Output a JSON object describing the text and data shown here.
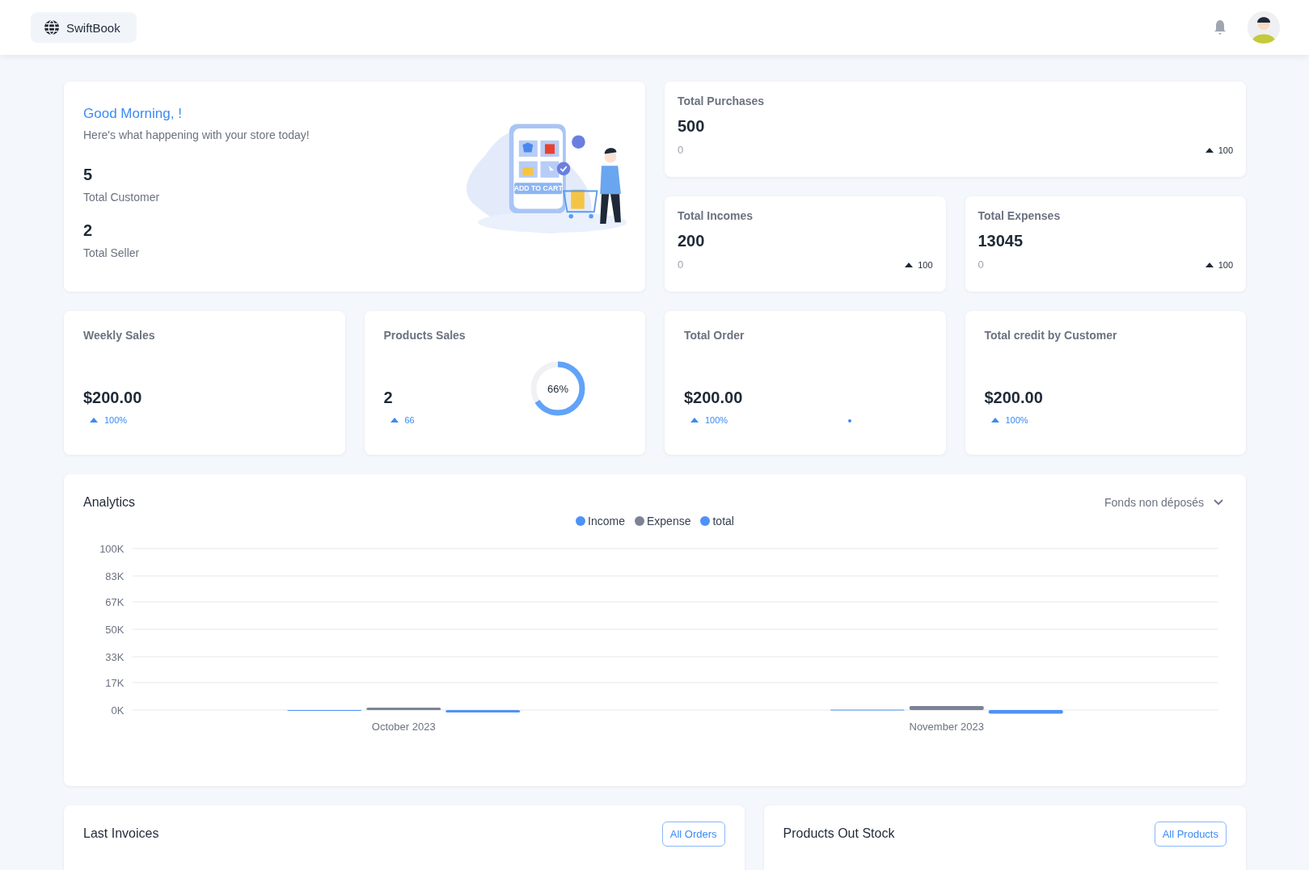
{
  "header": {
    "brand": "SwiftBook"
  },
  "greeting": {
    "title": "Good Morning, !",
    "subtitle": "Here's what happening with your store today!",
    "illustration_label": "ADD TO CART",
    "stats": [
      {
        "value": "5",
        "label": "Total Customer"
      },
      {
        "value": "2",
        "label": "Total Seller"
      }
    ]
  },
  "summary_cards": [
    {
      "label": "Total Purchases",
      "value": "500",
      "sub": "0",
      "trend": "100"
    },
    {
      "label": "Total Incomes",
      "value": "200",
      "sub": "0",
      "trend": "100"
    },
    {
      "label": "Total Expenses",
      "value": "13045",
      "sub": "0",
      "trend": "100"
    }
  ],
  "metric_cards": [
    {
      "kind": "plain",
      "label": "Weekly Sales",
      "value": "$200.00",
      "trend": "100%"
    },
    {
      "kind": "donut",
      "label": "Products Sales",
      "value": "2",
      "trend": "66",
      "level": 0.66,
      "donut_label": "66%"
    },
    {
      "kind": "dot",
      "label": "Total Order",
      "value": "$200.00",
      "trend": "100%"
    },
    {
      "kind": "plain",
      "label": "Total credit by Customer",
      "value": "$200.00",
      "trend": "100%"
    }
  ],
  "analytics": {
    "title": "Analytics",
    "filter": "Fonds non déposés",
    "chart_data": {
      "type": "bar",
      "categories": [
        "October 2023",
        "November 2023"
      ],
      "ylim": [
        -3000,
        100000
      ],
      "grid": true,
      "yticks": [
        {
          "value": 0,
          "label": "0K"
        },
        {
          "value": 17000,
          "label": "17K"
        },
        {
          "value": 33000,
          "label": "33K"
        },
        {
          "value": 50000,
          "label": "50K"
        },
        {
          "value": 67000,
          "label": "67K"
        },
        {
          "value": 83000,
          "label": "83K"
        },
        {
          "value": 100000,
          "label": "100K"
        }
      ],
      "series": [
        {
          "name": "Income",
          "color": "#4e92f6",
          "values": [
            0,
            300
          ]
        },
        {
          "name": "Expense",
          "color": "#7c8396",
          "values": [
            1500,
            2500
          ]
        },
        {
          "name": "total",
          "color": "#4e92f6",
          "values": [
            -1500,
            -2300
          ]
        }
      ]
    }
  },
  "panels": [
    {
      "title": "Last Invoices",
      "button": "All Orders"
    },
    {
      "title": "Products Out Stock",
      "button": "All Products"
    }
  ]
}
